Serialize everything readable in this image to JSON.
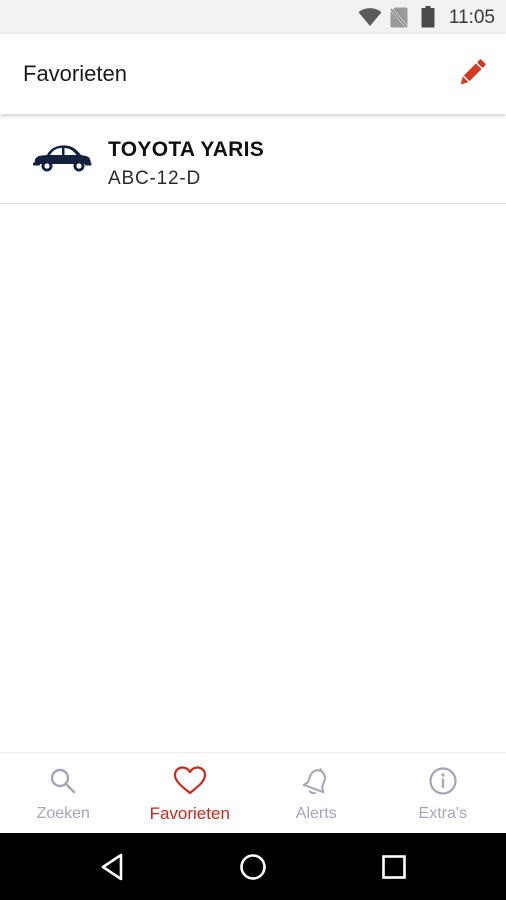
{
  "status_bar": {
    "time": "11:05",
    "icons": [
      "wifi-icon",
      "no-sim-icon",
      "battery-icon"
    ]
  },
  "app_bar": {
    "title": "Favorieten",
    "action_icon": "pencil-icon",
    "accent_color": "#d23a22"
  },
  "favorites": [
    {
      "icon": "car-icon",
      "name": "TOYOTA YARIS",
      "plate": "ABC-12-D"
    }
  ],
  "bottom_nav": {
    "active": "Favorieten",
    "active_color": "#c7291c",
    "inactive_color": "#a5a5b8",
    "items": [
      {
        "label": "Zoeken",
        "icon": "search-icon"
      },
      {
        "label": "Favorieten",
        "icon": "heart-icon"
      },
      {
        "label": "Alerts",
        "icon": "bell-icon"
      },
      {
        "label": "Extra's",
        "icon": "info-icon"
      }
    ]
  },
  "system_nav": {
    "buttons": [
      "back-icon",
      "home-icon",
      "recents-icon"
    ]
  }
}
